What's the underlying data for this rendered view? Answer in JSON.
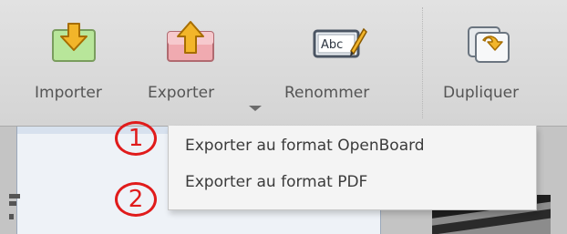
{
  "toolbar": {
    "buttons": [
      {
        "label": "Importer",
        "icon": "import-icon"
      },
      {
        "label": "Exporter",
        "icon": "export-icon"
      },
      {
        "label": "Renommer",
        "icon": "rename-icon"
      },
      {
        "label": "Dupliquer",
        "icon": "duplicate-icon"
      }
    ],
    "rename_icon_text": "Abc"
  },
  "export_menu": {
    "items": [
      {
        "label": "Exporter au format OpenBoard"
      },
      {
        "label": "Exporter au format PDF"
      }
    ]
  },
  "annotations": [
    {
      "number": "1"
    },
    {
      "number": "2"
    }
  ],
  "colors": {
    "callout": "#e01b1b",
    "import_box": "#b8e69a",
    "export_box": "#f0aab0",
    "arrow": "#f2b52a"
  }
}
